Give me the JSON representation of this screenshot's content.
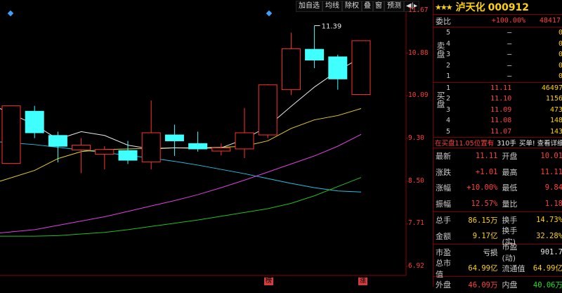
{
  "toolbar": {
    "buttons": [
      "加自选",
      "均线",
      "除权",
      "叠",
      "窗",
      "预测",
      "◀|▸"
    ]
  },
  "chart": {
    "y_ticks": [
      "11.67",
      "10.88",
      "10.09",
      "9.30",
      "8.50",
      "7.71",
      "6.92"
    ],
    "peak_label": "11.39",
    "x_tags": [
      "榜",
      "涨"
    ],
    "colors": {
      "up": "#ff3030",
      "down": "#40ffff",
      "ma5": "#e8e8e8",
      "ma10": "#e8d020",
      "ma20": "#e040e0",
      "ma30": "#20c020",
      "ma60": "#20c0e0"
    }
  },
  "chart_data": {
    "type": "candlestick",
    "ylim": [
      6.7,
      11.8
    ],
    "candles": [
      {
        "o": 8.83,
        "h": 9.9,
        "l": 8.83,
        "c": 9.9,
        "dir": "up"
      },
      {
        "o": 9.8,
        "h": 9.9,
        "l": 9.3,
        "c": 9.4,
        "dir": "down"
      },
      {
        "o": 9.35,
        "h": 9.42,
        "l": 8.85,
        "c": 9.15,
        "dir": "down"
      },
      {
        "o": 9.08,
        "h": 9.3,
        "l": 8.65,
        "c": 9.17,
        "dir": "up"
      },
      {
        "o": 9.09,
        "h": 9.15,
        "l": 8.72,
        "c": 9.0,
        "dir": "up"
      },
      {
        "o": 9.07,
        "h": 9.25,
        "l": 8.82,
        "c": 8.89,
        "dir": "down"
      },
      {
        "o": 8.86,
        "h": 10.0,
        "l": 8.72,
        "c": 9.4,
        "dir": "up"
      },
      {
        "o": 9.36,
        "h": 9.55,
        "l": 8.97,
        "c": 9.25,
        "dir": "down"
      },
      {
        "o": 9.2,
        "h": 9.42,
        "l": 9.05,
        "c": 9.1,
        "dir": "down"
      },
      {
        "o": 9.06,
        "h": 9.2,
        "l": 8.98,
        "c": 9.12,
        "dir": "up"
      },
      {
        "o": 9.1,
        "h": 9.86,
        "l": 8.93,
        "c": 9.4,
        "dir": "up"
      },
      {
        "o": 9.36,
        "h": 10.3,
        "l": 9.3,
        "c": 10.29,
        "dir": "up"
      },
      {
        "o": 10.2,
        "h": 11.26,
        "l": 10.1,
        "c": 10.96,
        "dir": "up"
      },
      {
        "o": 10.95,
        "h": 11.39,
        "l": 10.6,
        "c": 10.75,
        "dir": "down"
      },
      {
        "o": 10.81,
        "h": 10.85,
        "l": 10.2,
        "c": 10.4,
        "dir": "down"
      },
      {
        "o": 10.11,
        "h": 11.11,
        "l": 10.11,
        "c": 11.11,
        "dir": "up"
      }
    ],
    "ma5": [
      9.85,
      9.55,
      9.28,
      9.42,
      9.35,
      9.17,
      9.1,
      9.12,
      9.11,
      9.12,
      9.28,
      9.52,
      9.89,
      10.25,
      10.55,
      10.8
    ],
    "ma10": [
      8.5,
      8.7,
      8.92,
      9.05,
      9.09,
      9.1,
      9.11,
      9.12,
      9.12,
      9.13,
      9.15,
      9.25,
      9.48,
      9.64,
      9.72,
      9.85
    ],
    "ma20": [
      7.54,
      7.6,
      7.68,
      7.76,
      7.84,
      7.94,
      8.04,
      8.14,
      8.25,
      8.38,
      8.52,
      8.67,
      8.82,
      8.97,
      9.15,
      9.37
    ],
    "ma30": [
      7.48,
      7.48,
      7.49,
      7.52,
      7.55,
      7.6,
      7.66,
      7.72,
      7.78,
      7.85,
      7.92,
      7.99,
      8.09,
      8.23,
      8.4,
      8.57
    ],
    "ma60": [
      9.23,
      9.18,
      9.13,
      9.08,
      9.03,
      8.98,
      8.93,
      8.87,
      8.8,
      8.72,
      8.64,
      8.55,
      8.46,
      8.38,
      8.32,
      8.3
    ]
  },
  "panel": {
    "stars": "★★★",
    "name": "泸天化",
    "code": "000912",
    "weibi": {
      "label": "委比",
      "pct": "+100.00%",
      "diff": "48417"
    },
    "sell_label": "卖盘",
    "buy_label": "买盘",
    "sell": [
      {
        "lv": "5",
        "price": "—",
        "vol": "0"
      },
      {
        "lv": "4",
        "price": "—",
        "vol": "0"
      },
      {
        "lv": "3",
        "price": "—",
        "vol": "0"
      },
      {
        "lv": "2",
        "price": "—",
        "vol": "0"
      },
      {
        "lv": "1",
        "price": "—",
        "vol": "0"
      }
    ],
    "buy": [
      {
        "lv": "1",
        "price": "11.11",
        "vol": "46497"
      },
      {
        "lv": "2",
        "price": "11.10",
        "vol": "1156"
      },
      {
        "lv": "3",
        "price": "11.09",
        "vol": "473"
      },
      {
        "lv": "4",
        "price": "11.08",
        "vol": "148"
      },
      {
        "lv": "5",
        "price": "11.07",
        "vol": "143"
      }
    ],
    "info": {
      "left": "在买盘11.05位置有",
      "mid": "310手",
      "right": "买单! 查看详细"
    },
    "quotes": [
      {
        "l1": "最新",
        "v1": "11.11",
        "c1": "red",
        "l2": "开盘",
        "v2": "10.01",
        "c2": "red"
      },
      {
        "l1": "涨跌",
        "v1": "+1.01",
        "c1": "red",
        "l2": "最高",
        "v2": "11.11",
        "c2": "red"
      },
      {
        "l1": "涨幅",
        "v1": "+10.00%",
        "c1": "red",
        "l2": "最低",
        "v2": "9.84",
        "c2": "red"
      },
      {
        "l1": "振幅",
        "v1": "12.57%",
        "c1": "red",
        "l2": "量比",
        "v2": "1.18",
        "c2": "red"
      },
      {
        "l1": "总手",
        "v1": "86.15万",
        "c1": "yellow",
        "l2": "换手",
        "v2": "14.73%",
        "c2": "yellow"
      },
      {
        "l1": "金额",
        "v1": "9.17亿",
        "c1": "yellow",
        "l2": "换手(实)",
        "v2": "32.28%",
        "c2": "yellow"
      },
      {
        "l1": "市盈",
        "v1": "亏损",
        "c1": "white",
        "l2": "市盈(动)",
        "v2": "901.7",
        "c2": "white"
      },
      {
        "l1": "总市值",
        "v1": "64.99亿",
        "c1": "yellow",
        "l2": "流通值",
        "v2": "64.99亿",
        "c2": "yellow"
      },
      {
        "l1": "外盘",
        "v1": "46.09万",
        "c1": "red",
        "l2": "内盘",
        "v2": "40.06万",
        "c2": "green"
      }
    ]
  }
}
